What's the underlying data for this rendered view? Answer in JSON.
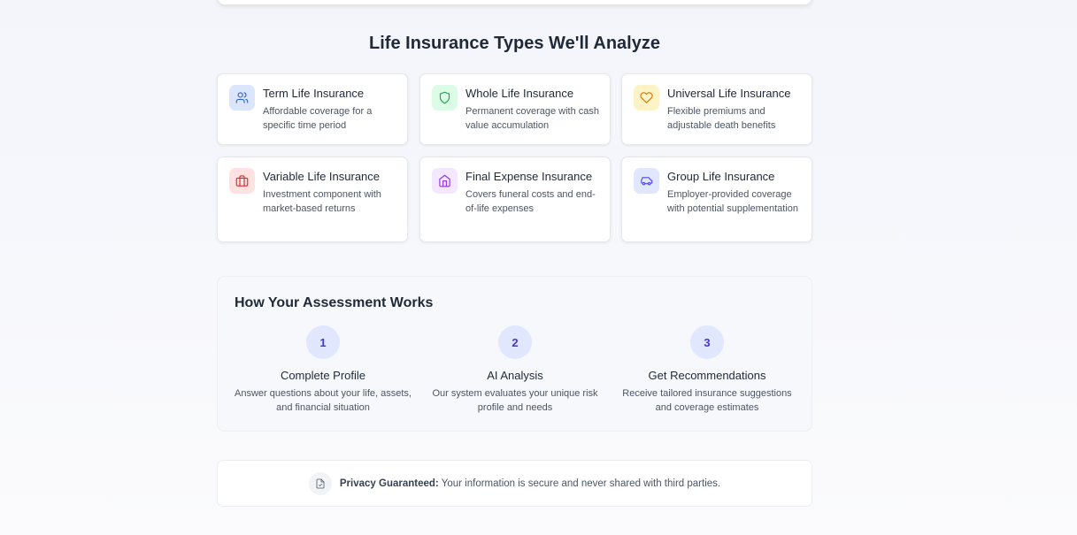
{
  "types_section": {
    "title": "Life Insurance Types We'll Analyze",
    "cards": [
      {
        "title": "Term Life Insurance",
        "desc": "Affordable coverage for a specific time period",
        "icon": "users-icon",
        "bg": "#dbe6fe",
        "color": "#2563eb"
      },
      {
        "title": "Whole Life Insurance",
        "desc": "Permanent coverage with cash value accumulation",
        "icon": "shield-icon",
        "bg": "#dcfce7",
        "color": "#16a34a"
      },
      {
        "title": "Universal Life Insurance",
        "desc": "Flexible premiums and adjustable death benefits",
        "icon": "heart-icon",
        "bg": "#fef3c7",
        "color": "#d97706"
      },
      {
        "title": "Variable Life Insurance",
        "desc": "Investment component with market-based returns",
        "icon": "briefcase-icon",
        "bg": "#fee2e2",
        "color": "#dc2626"
      },
      {
        "title": "Final Expense Insurance",
        "desc": "Covers funeral costs and end-of-life expenses",
        "icon": "home-icon",
        "bg": "#f3e8ff",
        "color": "#9333ea"
      },
      {
        "title": "Group Life Insurance",
        "desc": "Employer-provided coverage with potential supplementation",
        "icon": "car-icon",
        "bg": "#e0e7ff",
        "color": "#4f46e5"
      }
    ]
  },
  "how_section": {
    "title": "How Your Assessment Works",
    "steps": [
      {
        "num": "1",
        "title": "Complete Profile",
        "desc": "Answer questions about your life, assets, and financial situation"
      },
      {
        "num": "2",
        "title": "AI Analysis",
        "desc": "Our system evaluates your unique risk profile and needs"
      },
      {
        "num": "3",
        "title": "Get Recommendations",
        "desc": "Receive tailored insurance suggestions and coverage estimates"
      }
    ]
  },
  "privacy": {
    "icon": "file-check-icon",
    "strong": "Privacy Guaranteed:",
    "text": " Your information is secure and never shared with third parties."
  }
}
